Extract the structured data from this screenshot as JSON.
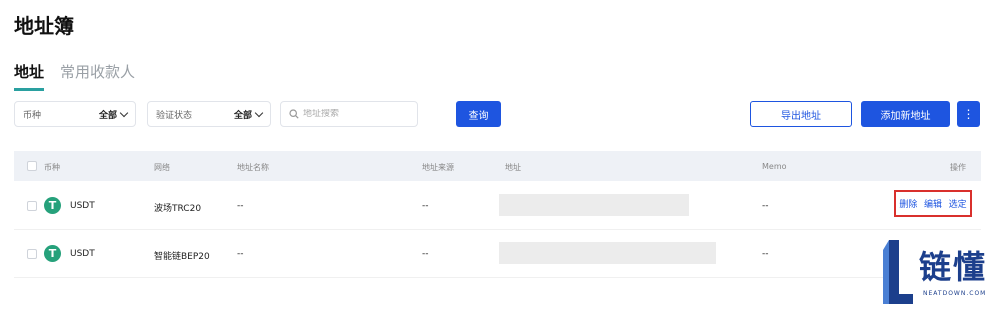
{
  "page": {
    "title": "地址簿"
  },
  "tabs": [
    {
      "label": "地址",
      "active": true
    },
    {
      "label": "常用收款人",
      "active": false
    }
  ],
  "filters": {
    "currency": {
      "label": "币种",
      "value": "全部"
    },
    "verify": {
      "label": "验证状态",
      "value": "全部"
    },
    "search": {
      "placeholder": "地址搜索"
    },
    "query_label": "查询"
  },
  "toolbar": {
    "export_label": "导出地址",
    "add_label": "添加新地址",
    "more_label": "⋮"
  },
  "table": {
    "headers": {
      "currency": "币种",
      "network": "网络",
      "name": "地址名称",
      "source": "地址来源",
      "address": "地址",
      "memo": "Memo",
      "ops": "操作"
    },
    "rows": [
      {
        "coin": "USDT",
        "network": "波场TRC20",
        "name": "--",
        "source": "--",
        "memo": "--"
      },
      {
        "coin": "USDT",
        "network": "智能链BEP20",
        "name": "--",
        "source": "--",
        "memo": "--"
      }
    ],
    "actions": {
      "delete": "删除",
      "edit": "编辑",
      "select": "选定"
    }
  },
  "watermark": {
    "text": "链懂",
    "sub": "NEATDOWN.COM"
  },
  "colors": {
    "primary": "#1e55e0",
    "accent_tab": "#2aa0a0",
    "tether": "#26a17b",
    "highlight": "#d9302c"
  }
}
